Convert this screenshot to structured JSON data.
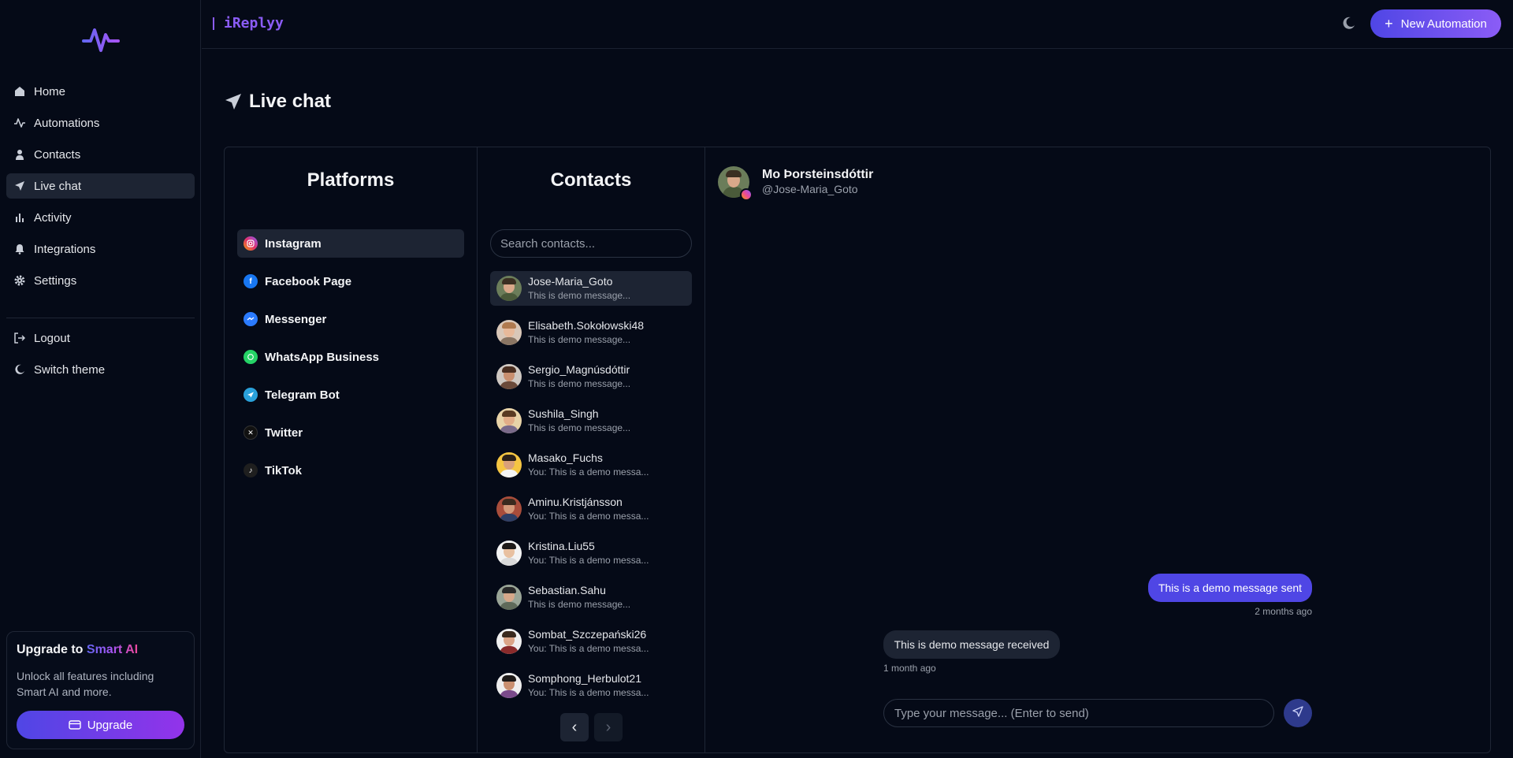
{
  "sidebar": {
    "nav": [
      {
        "label": "Home",
        "icon": "home-icon"
      },
      {
        "label": "Automations",
        "icon": "activity-icon"
      },
      {
        "label": "Contacts",
        "icon": "user-icon"
      },
      {
        "label": "Live chat",
        "icon": "send-icon",
        "active": true
      },
      {
        "label": "Activity",
        "icon": "bar-chart-icon"
      },
      {
        "label": "Integrations",
        "icon": "bell-icon"
      },
      {
        "label": "Settings",
        "icon": "gear-icon"
      }
    ],
    "secondary": [
      {
        "label": "Logout",
        "icon": "logout-icon"
      },
      {
        "label": "Switch theme",
        "icon": "moon-icon"
      }
    ],
    "upgrade": {
      "title_prefix": "Upgrade to ",
      "title_highlight": "Smart AI",
      "description": "Unlock all features including Smart AI and more.",
      "button_label": "Upgrade"
    }
  },
  "topbar": {
    "brand": "iReplyy",
    "new_button_label": "New Automation"
  },
  "page": {
    "title": "Live chat"
  },
  "platforms": {
    "title": "Platforms",
    "items": [
      {
        "label": "Instagram",
        "icon": "instagram-icon",
        "color": "#e1306c",
        "active": true
      },
      {
        "label": "Facebook Page",
        "icon": "facebook-icon",
        "color": "#1877f2"
      },
      {
        "label": "Messenger",
        "icon": "messenger-icon",
        "color": "#2b7bff"
      },
      {
        "label": "WhatsApp Business",
        "icon": "whatsapp-icon",
        "color": "#25d366"
      },
      {
        "label": "Telegram Bot",
        "icon": "telegram-icon",
        "color": "#2aa1da"
      },
      {
        "label": "Twitter",
        "icon": "x-icon",
        "color": "#111111"
      },
      {
        "label": "TikTok",
        "icon": "tiktok-icon",
        "color": "#1f1f1f"
      }
    ]
  },
  "contacts": {
    "title": "Contacts",
    "search_placeholder": "Search contacts...",
    "items": [
      {
        "name": "Jose-Maria_Goto",
        "preview": "This is demo message...",
        "active": true
      },
      {
        "name": "Elisabeth.Sokołowski48",
        "preview": "This is demo message..."
      },
      {
        "name": "Sergio_Magnúsdóttir",
        "preview": "This is demo message..."
      },
      {
        "name": "Sushila_Singh",
        "preview": "This is demo message..."
      },
      {
        "name": "Masako_Fuchs",
        "preview": "You: This is a demo messa..."
      },
      {
        "name": "Aminu.Kristjánsson",
        "preview": "You: This is a demo messa..."
      },
      {
        "name": "Kristina.Liu55",
        "preview": "You: This is a demo messa..."
      },
      {
        "name": "Sebastian.Sahu",
        "preview": "This is demo message..."
      },
      {
        "name": "Sombat_Szczepański26",
        "preview": "You: This is a demo messa..."
      },
      {
        "name": "Somphong_Herbulot21",
        "preview": "You: This is a demo messa..."
      }
    ],
    "pager_prev": "‹",
    "pager_next": "›"
  },
  "chat": {
    "name": "Mo Þorsteinsdóttir",
    "handle": "@Jose-Maria_Goto",
    "messages": [
      {
        "direction": "sent",
        "text": "This is a demo message sent",
        "time": "2 months ago"
      },
      {
        "direction": "received",
        "text": "This is demo message received",
        "time": "1 month ago"
      }
    ],
    "input_placeholder": "Type your message... (Enter to send)"
  },
  "colors": {
    "background": "#050a17",
    "accent": "#4f46e5",
    "accent_purple": "#8b5cf6",
    "surface": "#1d2433"
  }
}
